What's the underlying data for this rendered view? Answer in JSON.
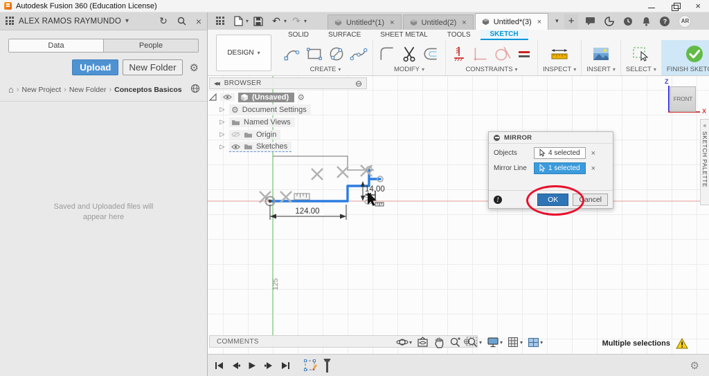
{
  "window": {
    "title": "Autodesk Fusion 360 (Education License)"
  },
  "icons": {
    "chevron_down": "▾",
    "close": "×",
    "refresh": "↻",
    "breadcrumb_sep": "›",
    "expand_arrow": "▷",
    "collapse_left": "◀◀",
    "circle_minus": "⊖",
    "target_radio": "⊙",
    "gear": "⚙",
    "plus": "+",
    "undo": "↶",
    "redo": "↷",
    "home": "⌂",
    "question": "?",
    "warning": "!",
    "palette_collapse": "«"
  },
  "data_panel": {
    "user": "ALEX RAMOS RAYMUNDO",
    "tabs": [
      {
        "label": "Data"
      },
      {
        "label": "People"
      }
    ],
    "upload_label": "Upload",
    "new_folder_label": "New Folder",
    "breadcrumb": [
      "New Project",
      "New Folder",
      "Conceptos Basicos"
    ],
    "empty_line1": "Saved and Uploaded files will",
    "empty_line2": "appear here"
  },
  "document_tabs": [
    {
      "label": "Untitled*(1)"
    },
    {
      "label": "Untitled(2)"
    },
    {
      "label": "Untitled*(3)"
    }
  ],
  "profile_initials": "AR",
  "ribbon": {
    "env_label": "DESIGN",
    "tabs": [
      "SOLID",
      "SURFACE",
      "SHEET METAL",
      "TOOLS",
      "SKETCH"
    ],
    "groups": [
      "CREATE",
      "MODIFY",
      "CONSTRAINTS",
      "INSPECT",
      "INSERT",
      "SELECT",
      "FINISH SKETCH"
    ]
  },
  "browser": {
    "title": "BROWSER",
    "items": [
      {
        "label": "(Unsaved)"
      },
      {
        "label": "Document Settings"
      },
      {
        "label": "Named Views"
      },
      {
        "label": "Origin"
      },
      {
        "label": "Sketches"
      }
    ]
  },
  "sketch": {
    "dim_horizontal": "124.00",
    "dim_vertical": "14.00",
    "grid_label": "125"
  },
  "mirror_dialog": {
    "title": "MIRROR",
    "rows": [
      {
        "label": "Objects",
        "value": "4 selected"
      },
      {
        "label": "Mirror Line",
        "value": "1 selected"
      }
    ],
    "ok_label": "OK",
    "cancel_label": "Cancel"
  },
  "viewcube": {
    "face": "FRONT",
    "axis_z": "Z",
    "axis_x": "X"
  },
  "sketch_palette_label": "SKETCH PALETTE",
  "comments_label": "COMMENTS",
  "status": {
    "selection_text": "Multiple selections"
  },
  "colors": {
    "accent_blue": "#0696d7",
    "selection_blue": "#2b7de0",
    "finish_green": "#62bb46",
    "annotation_red": "#e8112d"
  }
}
